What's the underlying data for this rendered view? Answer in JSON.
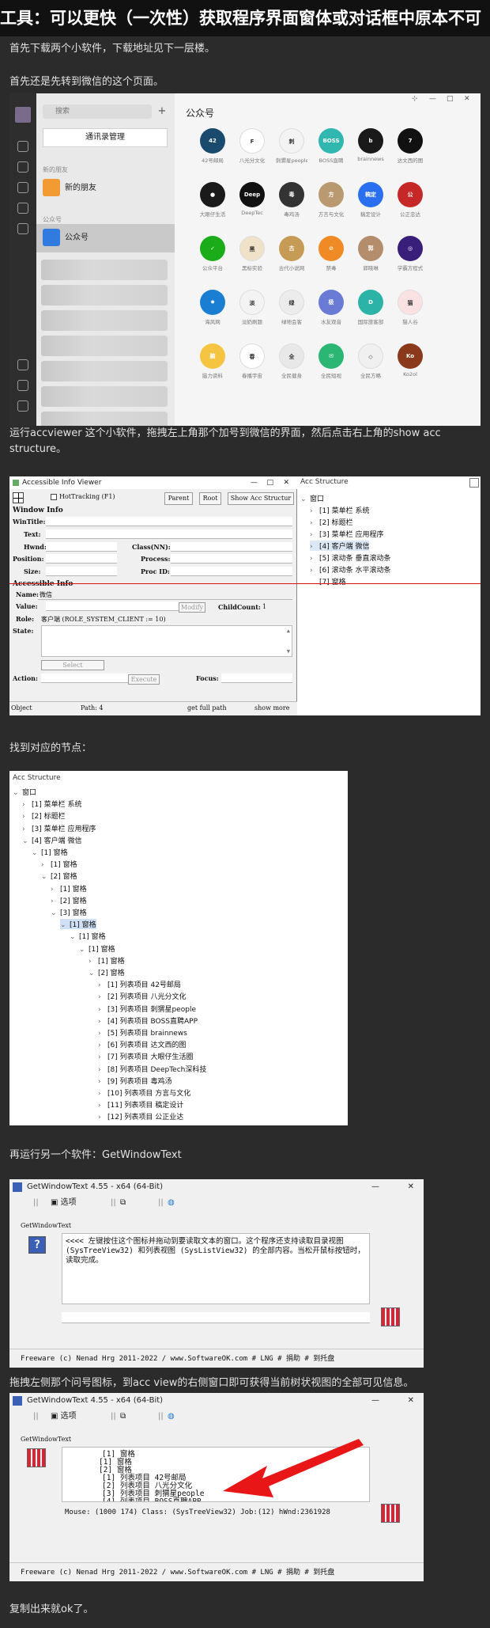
{
  "article": {
    "title": "工具：可以更快（一次性）获取程序界面窗体或对话框中原本不可",
    "p1": "首先下载两个小软件，下载地址见下一层楼。",
    "p2": "首先还是先转到微信的这个页面。",
    "p3": "运行accviewer 这个小软件，拖拽左上角那个加号到微信的界面，然后点击右上角的show acc structure。",
    "p4": "找到对应的节点：",
    "p5": "再运行另一个软件：GetWindowText",
    "p6": "拖拽左侧那个问号图标，到acc view的右侧窗口即可获得当前树状视图的全部可见信息。",
    "p7": "复制出来就ok了。"
  },
  "wechat": {
    "search_placeholder": "搜索",
    "add_icon": "plus",
    "contacts_button": "通讯录管理",
    "section_new": "新的朋友",
    "new_friends": "新的朋友",
    "section_official": "公众号",
    "official_accounts": "公众号",
    "main_title": "公众号",
    "window_controls": [
      "⊹",
      "—",
      "□",
      "✕"
    ],
    "accounts": [
      {
        "name": "42号邮局",
        "abbr": "42",
        "color": "#1a4a6e"
      },
      {
        "name": "八光分文化",
        "abbr": "F",
        "color": "#ffffff"
      },
      {
        "name": "刺猬星people",
        "abbr": "刺",
        "color": "#f3f3f3"
      },
      {
        "name": "BOSS直聘",
        "abbr": "BOSS",
        "color": "#2fb7b0"
      },
      {
        "name": "brainnews",
        "abbr": "b",
        "color": "#1a1a1a"
      },
      {
        "name": "达文西的图",
        "abbr": "7",
        "color": "#111111"
      },
      {
        "name": "大眼仔生活",
        "abbr": "●",
        "color": "#1a1a1a"
      },
      {
        "name": "DeepTec",
        "abbr": "Deep",
        "color": "#111111"
      },
      {
        "name": "毒鸡汤",
        "abbr": "毒",
        "color": "#333333"
      },
      {
        "name": "方言与文化",
        "abbr": "方",
        "color": "#b99a70"
      },
      {
        "name": "稿定设计",
        "abbr": "稿定",
        "color": "#2a6ff0"
      },
      {
        "name": "公正忠达",
        "abbr": "公",
        "color": "#c62828"
      },
      {
        "name": "公众平台",
        "abbr": "✓",
        "color": "#1aad19"
      },
      {
        "name": "黑标实验",
        "abbr": "黑",
        "color": "#f0e2c8"
      },
      {
        "name": "古代小说网",
        "abbr": "古",
        "color": "#c59b55"
      },
      {
        "name": "禁毒",
        "abbr": "⊘",
        "color": "#f08a24"
      },
      {
        "name": "郭晓琳",
        "abbr": "郭",
        "color": "#b38d6c"
      },
      {
        "name": "学霸方程式",
        "abbr": "◎",
        "color": "#3a1f7a"
      },
      {
        "name": "海风网",
        "abbr": "✸",
        "color": "#1a7fd3"
      },
      {
        "name": "淡奶刷题",
        "abbr": "淡",
        "color": "#f3f3f3"
      },
      {
        "name": "绿地会客",
        "abbr": "绿",
        "color": "#ececec"
      },
      {
        "name": "水友观音",
        "abbr": "极",
        "color": "#6a7bd6"
      },
      {
        "name": "国际旅客部",
        "abbr": "D",
        "color": "#2bb3a8"
      },
      {
        "name": "猫人谷",
        "abbr": "猫",
        "color": "#fbe2e2"
      },
      {
        "name": "脑力资料",
        "abbr": "脑",
        "color": "#f5c542"
      },
      {
        "name": "春播宇宙",
        "abbr": "春",
        "color": "#ffffff"
      },
      {
        "name": "全民健身",
        "abbr": "全",
        "color": "#e8e8e8"
      },
      {
        "name": "全民短视",
        "abbr": "✉",
        "color": "#2bb673"
      },
      {
        "name": "全民方略",
        "abbr": "◇",
        "color": "#f0f0f0"
      },
      {
        "name": "Ko2ol",
        "abbr": "Ko",
        "color": "#8a3a1a"
      }
    ]
  },
  "accviewer": {
    "title": "Accessible Info Viewer",
    "hot_tracking": "HotTracking (F1)",
    "btn_parent": "Parent",
    "btn_root": "Root",
    "btn_show_acc": "Show Acc Structur",
    "window_info": "Window Info",
    "labels": [
      "WinTitle:",
      "Text:",
      "Hwnd:",
      "Position:",
      "Size:"
    ],
    "labels_right": [
      "Class(NN):",
      "Process:",
      "Proc ID:"
    ],
    "acc_info": "Accessible Info",
    "name_label": "Name:",
    "name_value": "微信",
    "value_label": "Value:",
    "modify": "Modify",
    "child_count_label": "ChildCount:",
    "child_count_value": "1",
    "role_label": "Role:",
    "role_value": "客户端 (ROLE_SYSTEM_CLIENT := 10)",
    "state_label": "State:",
    "select": "Select",
    "action_label": "Action:",
    "execute": "Execute",
    "focus_label": "Focus:",
    "status_object": "Object",
    "status_path": "Path: 4",
    "status_get_full": "get full path",
    "status_show_more": "show more",
    "acc_structure_title": "Acc Structure",
    "tree_small": [
      "窗口",
      "[1] 菜单栏 系统",
      "[2] 标题栏",
      "[3] 菜单栏 应用程序",
      "[4] 客户端 微信",
      "[5] 滚动条 垂直滚动条",
      "[6] 滚动条 水平滚动条",
      "[7] 窗格"
    ]
  },
  "acc_tree": {
    "title": "Acc Structure",
    "rows": [
      {
        "text": "窗口",
        "indent": 0,
        "arrow": "v"
      },
      {
        "text": "[1] 菜单栏 系统",
        "indent": 1,
        "arrow": ">"
      },
      {
        "text": "[2] 标题栏",
        "indent": 1,
        "arrow": ">"
      },
      {
        "text": "[3] 菜单栏 应用程序",
        "indent": 1,
        "arrow": ">"
      },
      {
        "text": "[4] 客户端 微信",
        "indent": 1,
        "arrow": "v"
      },
      {
        "text": "[1] 窗格",
        "indent": 2,
        "arrow": "v"
      },
      {
        "text": "[1] 窗格",
        "indent": 3,
        "arrow": ">"
      },
      {
        "text": "[2] 窗格",
        "indent": 3,
        "arrow": "v"
      },
      {
        "text": "[1] 窗格",
        "indent": 4,
        "arrow": ">"
      },
      {
        "text": "[2] 窗格",
        "indent": 4,
        "arrow": ">"
      },
      {
        "text": "[3] 窗格",
        "indent": 4,
        "arrow": "v"
      },
      {
        "text": "[1] 窗格",
        "indent": 5,
        "arrow": "v",
        "sel": true
      },
      {
        "text": "[1] 窗格",
        "indent": 6,
        "arrow": "v"
      },
      {
        "text": "[1] 窗格",
        "indent": 7,
        "arrow": "v"
      },
      {
        "text": "[1] 窗格",
        "indent": 8,
        "arrow": ">"
      },
      {
        "text": "[2] 窗格",
        "indent": 8,
        "arrow": "v"
      },
      {
        "text": "[1] 列表项目 42号邮局",
        "indent": 9,
        "arrow": ">"
      },
      {
        "text": "[2] 列表项目 八光分文化",
        "indent": 9,
        "arrow": ">"
      },
      {
        "text": "[3] 列表项目 刺猬星people",
        "indent": 9,
        "arrow": ">"
      },
      {
        "text": "[4] 列表项目 BOSS直聘APP",
        "indent": 9,
        "arrow": ">"
      },
      {
        "text": "[5] 列表项目 brainnews",
        "indent": 9,
        "arrow": ">"
      },
      {
        "text": "[6] 列表项目 达文西的图",
        "indent": 9,
        "arrow": ">"
      },
      {
        "text": "[7] 列表项目 大眼仔生活圈",
        "indent": 9,
        "arrow": ">"
      },
      {
        "text": "[8] 列表项目 DeepTech深科技",
        "indent": 9,
        "arrow": ">"
      },
      {
        "text": "[9] 列表项目 毒鸡汤",
        "indent": 9,
        "arrow": ">"
      },
      {
        "text": "[10] 列表项目 方言与文化",
        "indent": 9,
        "arrow": ">"
      },
      {
        "text": "[11] 列表项目 稿定设计",
        "indent": 9,
        "arrow": ">"
      },
      {
        "text": "[12] 列表项目 公正业达",
        "indent": 9,
        "arrow": ">"
      }
    ]
  },
  "gwt1": {
    "title": "GetWindowText 4.55 - x64 (64-Bit)",
    "menu_options": "选项",
    "label": "GetWindowText",
    "text": "<<<< 左键按住这个图标并拖动到要读取文本的窗口。这个程序还支持读取目录视图 (SysTreeView32) 和列表视图 (SysListView32) 的全部内容。当松开鼠标按钮时，读取完成。",
    "footer": "Freeware (c) Nenad Hrg 2011-2022 / www.SoftwareOK.com  # LNG  # 捐助  # 到托盘"
  },
  "gwt2": {
    "title": "GetWindowText 4.55 - x64 (64-Bit)",
    "menu_options": "选项",
    "label": "GetWindowText",
    "lines": [
      "[1] 窗格",
      "[1] 窗格",
      "[2] 窗格",
      "[1] 列表项目 42号邮局",
      "[2] 列表项目 八光分文化",
      "[3] 列表项目 刺猬星people",
      "[4] 列表项目 BOSS直聘APP"
    ],
    "mouse_info": "Mouse: (1000 174) Class: (SysTreeView32) Job:(12) hWnd:2361928",
    "footer": "Freeware (c) Nenad Hrg 2011-2022 / www.SoftwareOK.com  # LNG  # 捐助  # 到托盘"
  }
}
